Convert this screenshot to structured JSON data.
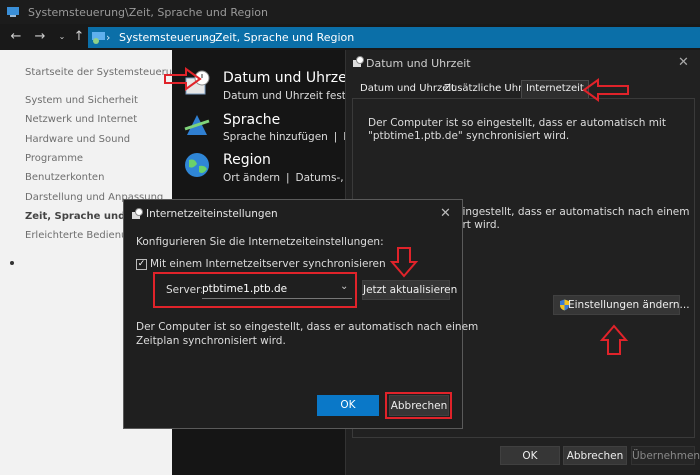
{
  "window": {
    "title": "Systemsteuerung\\Zeit, Sprache und Region"
  },
  "address": {
    "crumbs": [
      "Systemsteuerung",
      "Zeit, Sprache und Region"
    ],
    "separator": "›"
  },
  "sidebar": {
    "items": [
      "Startseite der Systemsteuerung",
      "System und Sicherheit",
      "Netzwerk und Internet",
      "Hardware und Sound",
      "Programme",
      "Benutzerkonten",
      "Darstellung und Anpassung",
      "Zeit, Sprache und Region",
      "Erleichterte Bedienung"
    ],
    "active_index": 7
  },
  "categories": [
    {
      "title": "Datum und Uhrzeit",
      "sub": "Datum und Uhrzeit festlegen"
    },
    {
      "title": "Sprache",
      "sub": "Sprache hinzufügen  ❘  Ein"
    },
    {
      "title": "Region",
      "sub": "Ort ändern  ❘  Datums-, Uh"
    }
  ],
  "dialog_datetime": {
    "title": "Datum und Uhrzeit",
    "tabs": [
      "Datum und Uhrzeit",
      "Zusätzliche Uhren",
      "Internetzeit"
    ],
    "active_tab": 2,
    "text1": "Der Computer ist so eingestellt, dass er automatisch mit \"ptbtime1.ptb.de\" synchronisiert wird.",
    "text2_fragment": "eingestellt, dass er automatisch nach einem",
    "text2_fragment2": "ert wird.",
    "change_button": "Einstellungen ändern...",
    "ok": "OK",
    "cancel": "Abbrechen",
    "apply": "Übernehmen"
  },
  "dialog_inet": {
    "title": "Internetzeiteinstellungen",
    "heading": "Konfigurieren Sie die Internetzeiteinstellungen:",
    "checkbox_label": "Mit einem Internetzeitserver synchronisieren",
    "checkbox_checked": true,
    "server_label": "Server:",
    "server_value": "ptbtime1.ptb.de",
    "update_button": "Jetzt aktualisieren",
    "info_line1": "Der Computer ist so eingestellt, dass er automatisch nach einem",
    "info_line2": "Zeitplan synchronisiert wird.",
    "ok": "OK",
    "cancel": "Abbrechen"
  },
  "colors": {
    "accent": "#0b6fa8",
    "annotation": "#e0232a",
    "ok_button": "#0a78c8"
  }
}
